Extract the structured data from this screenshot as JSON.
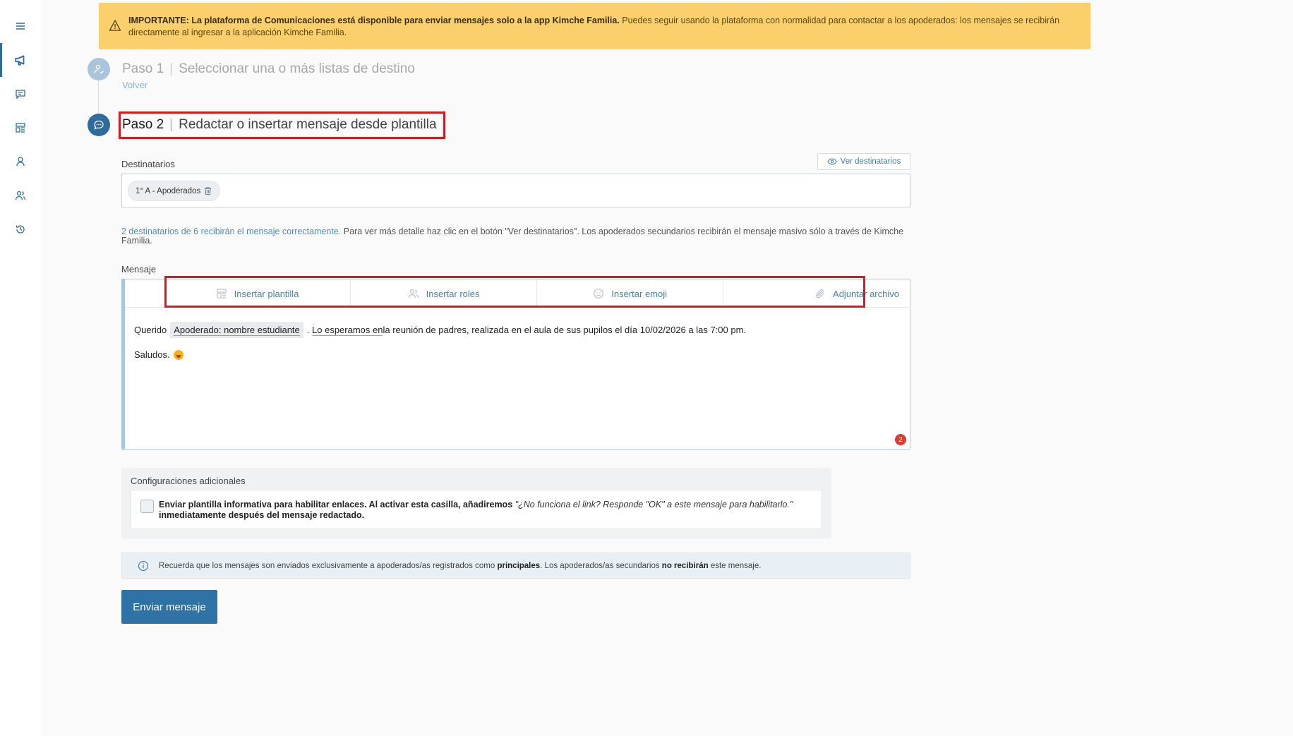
{
  "sidebar": {
    "items": [
      {
        "icon": "menu-icon"
      },
      {
        "icon": "megaphone-icon",
        "active": true
      },
      {
        "icon": "chat-icon"
      },
      {
        "icon": "template-icon"
      },
      {
        "icon": "user-icon"
      },
      {
        "icon": "users-icon"
      },
      {
        "icon": "history-icon"
      }
    ]
  },
  "banner": {
    "bold": "IMPORTANTE: La plataforma de Comunicaciones está disponible para enviar mensajes solo a la app Kimche Familia.",
    "text": " Puedes seguir usando la plataforma con normalidad para contactar a los apoderados: los mensajes se recibirán directamente al ingresar a la aplicación Kimche Familia."
  },
  "step1": {
    "label": "Paso 1",
    "sep": "|",
    "title": "Seleccionar una o más listas de destino",
    "back": "Volver"
  },
  "step2": {
    "label": "Paso 2",
    "sep": "|",
    "title": "Redactar o insertar mensaje desde plantilla"
  },
  "recipients": {
    "label": "Destinatarios",
    "view_button": "Ver destinatarios",
    "chip": "1° A - Apoderados",
    "info_highlight": "2 destinatarios de 6 recibirán el mensaje correctamente.",
    "info_text": " Para ver más detalle haz clic en el botón \"Ver destinatarios\". Los apoderados secundarios recibirán el mensaje masivo sólo a través de Kimche Familia."
  },
  "message": {
    "label": "Mensaje",
    "toolbar": {
      "template": "Insertar plantilla",
      "roles": "Insertar roles",
      "emoji": "Insertar emoji",
      "attach": "Adjuntar archivo"
    },
    "line1_start": "Querido",
    "tag": "Apoderado: nombre estudiante",
    "line1_dot": ".",
    "line1_underlined": "Lo esperamos en",
    "line1_end": " la reunión de padres, realizada en el aula de sus pupilos el día 10/02/2026 a las 7:00 pm.",
    "line2": "Saludos.",
    "badge": "2"
  },
  "config": {
    "title": "Configuraciones adicionales",
    "bold": "Enviar plantilla informativa para habilitar enlaces. Al activar esta casilla, añadiremos",
    "italic": " \"¿No funciona el link? Responde \"OK\" a este mensaje para habilitarlo.\"",
    "bold2": "inmediatamente después del mensaje redactado."
  },
  "notice": {
    "t1": "Recuerda que los mensajes son enviados exclusivamente a apoderados/as registrados como ",
    "b1": "principales",
    "t2": ". Los apoderados/as secundarios ",
    "b2": "no recibirán",
    "t3": " este mensaje."
  },
  "send_button": "Enviar mensaje",
  "colors": {
    "accent": "#2f6b9c",
    "banner": "#fbcf6b",
    "highlight_box": "#d71a21",
    "badge": "#e03a2f"
  }
}
